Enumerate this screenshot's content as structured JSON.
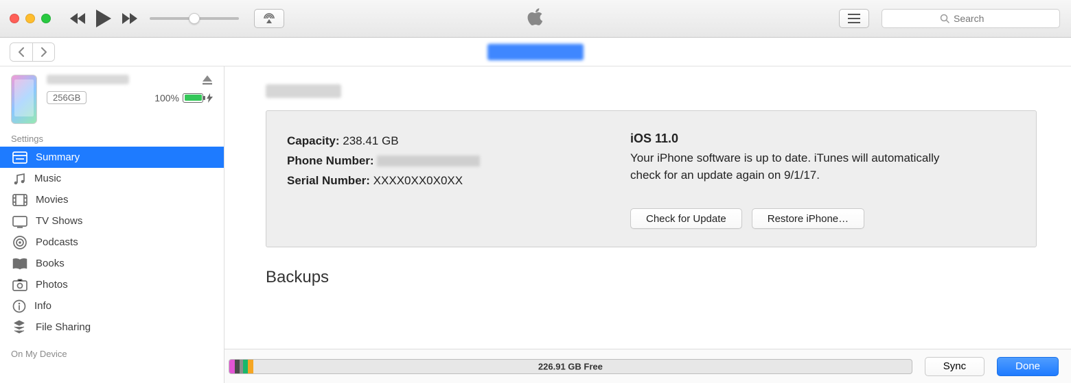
{
  "toolbar": {
    "search_placeholder": "Search"
  },
  "sidebar": {
    "device": {
      "storage_chip": "256GB",
      "battery_pct": "100%"
    },
    "group1_label": "Settings",
    "items": [
      {
        "label": "Summary"
      },
      {
        "label": "Music"
      },
      {
        "label": "Movies"
      },
      {
        "label": "TV Shows"
      },
      {
        "label": "Podcasts"
      },
      {
        "label": "Books"
      },
      {
        "label": "Photos"
      },
      {
        "label": "Info"
      },
      {
        "label": "File Sharing"
      }
    ],
    "group2_label": "On My Device"
  },
  "summary": {
    "capacity_label": "Capacity:",
    "capacity_value": "238.41 GB",
    "phone_label": "Phone Number:",
    "serial_label": "Serial Number:",
    "serial_value": "XXXX0XX0X0XX",
    "os_title": "iOS 11.0",
    "os_text": "Your iPhone software is up to date. iTunes will automatically check for an update again on 9/1/17.",
    "check_btn": "Check for Update",
    "restore_btn": "Restore iPhone…"
  },
  "backups_heading": "Backups",
  "bottom": {
    "free_label": "226.91 GB Free",
    "sync": "Sync",
    "done": "Done",
    "segments": [
      {
        "color": "#e255d4",
        "left": 0.0,
        "width": 0.8
      },
      {
        "color": "#4a4a4a",
        "left": 0.8,
        "width": 0.7
      },
      {
        "color": "#8e8e8e",
        "left": 1.5,
        "width": 0.5
      },
      {
        "color": "#19b86b",
        "left": 2.0,
        "width": 0.7
      },
      {
        "color": "#f5a623",
        "left": 2.7,
        "width": 0.8
      }
    ]
  }
}
